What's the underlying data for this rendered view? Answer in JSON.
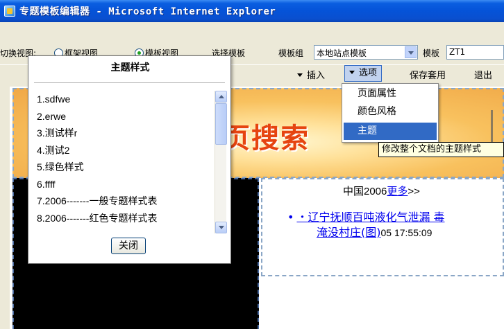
{
  "window": {
    "title": "专题模板编辑器 - Microsoft Internet Explorer"
  },
  "toolbar1": {
    "switch_view_label": "切换视图:",
    "frame_view_label": "框架视图",
    "template_view_label": "模板视图",
    "select_template_label": "选择模板",
    "template_group_label": "模板组",
    "template_group_value": "本地站点模板",
    "template_label": "模板",
    "template_value": "ZT1"
  },
  "toolbar2": {
    "insert_label": "插入",
    "options_label": "选项",
    "save_apply_label": "保存套用",
    "exit_label": "退出"
  },
  "options_menu": {
    "items": [
      "页面属性",
      "颜色风格",
      "主题"
    ],
    "selected": "主题",
    "tooltip": "修改整个文档的主题样式"
  },
  "theme_dialog": {
    "title": "主题样式",
    "items": [
      "1.sdfwe",
      "2.erwe",
      "3.测试样r",
      "4.测试2",
      "5.绿色样式",
      "6.ffff",
      "7.2006-------一般专题样式表",
      "8.2006-------红色专题样式表"
    ],
    "close_label": "关闭"
  },
  "canvas": {
    "banner_text": "页搜索",
    "news_head_prefix": "中国2006",
    "news_head_more": "更多",
    "news_head_suffix": ">>",
    "news_item_line1": "・辽宁抚顺百吨液化气泄漏 毒",
    "news_item_line2": "淹没村庄(图)",
    "news_item_date": "05 17:55:09"
  }
}
